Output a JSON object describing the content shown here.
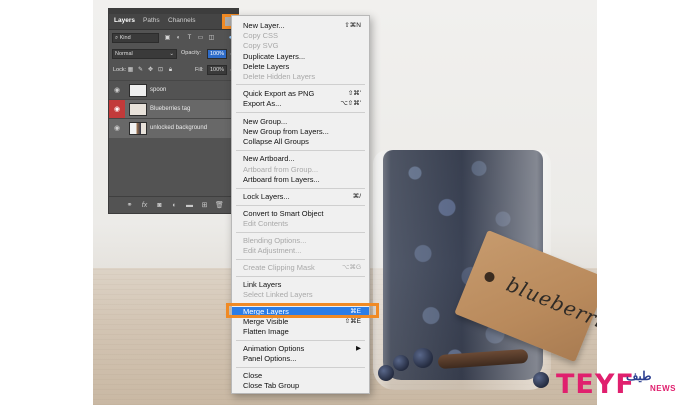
{
  "panel": {
    "tabs": [
      "Layers",
      "Paths",
      "Channels"
    ],
    "filter_kind": "Kind",
    "blend_mode": "Normal",
    "opacity_label": "Opacity:",
    "opacity_value": "100%",
    "lock_label": "Lock:",
    "fill_label": "Fill:",
    "fill_value": "100%",
    "layers": [
      {
        "name": "spoon",
        "visible": true,
        "selected": false
      },
      {
        "name": "Blueberries tag",
        "visible": true,
        "selected": true
      },
      {
        "name": "unlocked background",
        "visible": true,
        "selected": false
      }
    ]
  },
  "menu": {
    "items": [
      {
        "label": "New Layer...",
        "shortcut": "⇧⌘N",
        "enabled": true
      },
      {
        "label": "Copy CSS",
        "shortcut": "",
        "enabled": false
      },
      {
        "label": "Copy SVG",
        "shortcut": "",
        "enabled": false
      },
      {
        "label": "Duplicate Layers...",
        "shortcut": "",
        "enabled": true
      },
      {
        "label": "Delete Layers",
        "shortcut": "",
        "enabled": true
      },
      {
        "label": "Delete Hidden Layers",
        "shortcut": "",
        "enabled": false
      },
      {
        "label": "Quick Export as PNG",
        "shortcut": "⇧⌘'",
        "enabled": true
      },
      {
        "label": "Export As...",
        "shortcut": "⌥⇧⌘'",
        "enabled": true
      },
      {
        "label": "New Group...",
        "shortcut": "",
        "enabled": true
      },
      {
        "label": "New Group from Layers...",
        "shortcut": "",
        "enabled": true
      },
      {
        "label": "Collapse All Groups",
        "shortcut": "",
        "enabled": true
      },
      {
        "label": "New Artboard...",
        "shortcut": "",
        "enabled": true
      },
      {
        "label": "Artboard from Group...",
        "shortcut": "",
        "enabled": false
      },
      {
        "label": "Artboard from Layers...",
        "shortcut": "",
        "enabled": true
      },
      {
        "label": "Lock Layers...",
        "shortcut": "⌘/",
        "enabled": true
      },
      {
        "label": "Convert to Smart Object",
        "shortcut": "",
        "enabled": true
      },
      {
        "label": "Edit Contents",
        "shortcut": "",
        "enabled": false
      },
      {
        "label": "Blending Options...",
        "shortcut": "",
        "enabled": false
      },
      {
        "label": "Edit Adjustment...",
        "shortcut": "",
        "enabled": false
      },
      {
        "label": "Create Clipping Mask",
        "shortcut": "⌥⌘G",
        "enabled": false
      },
      {
        "label": "Link Layers",
        "shortcut": "",
        "enabled": true
      },
      {
        "label": "Select Linked Layers",
        "shortcut": "",
        "enabled": false
      },
      {
        "label": "Merge Layers",
        "shortcut": "⌘E",
        "enabled": true
      },
      {
        "label": "Merge Visible",
        "shortcut": "⇧⌘E",
        "enabled": true
      },
      {
        "label": "Flatten Image",
        "shortcut": "",
        "enabled": true
      },
      {
        "label": "Animation Options",
        "shortcut": "▶",
        "enabled": true
      },
      {
        "label": "Panel Options...",
        "shortcut": "",
        "enabled": true
      },
      {
        "label": "Close",
        "shortcut": "",
        "enabled": true
      },
      {
        "label": "Close Tab Group",
        "shortcut": "",
        "enabled": true
      }
    ]
  },
  "photo": {
    "tag_text": "blueberries"
  },
  "watermark": {
    "brand": "TEYF",
    "arabic": "طيف",
    "news": "NEWS"
  },
  "colors": {
    "panel_bg": "#535353",
    "menu_bg": "#f0f0f0",
    "highlight_blue": "#2c7de6",
    "callout_orange": "#f08a24",
    "layer_eye_red": "#c23a3a",
    "watermark_pink": "#e0206e"
  }
}
